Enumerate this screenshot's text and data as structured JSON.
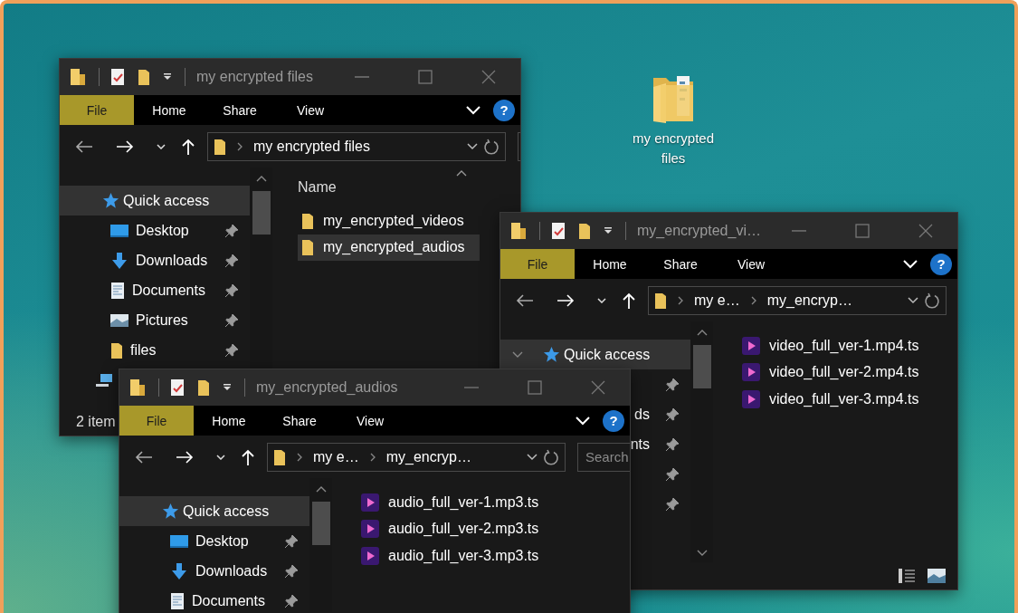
{
  "desktop": {
    "icon_label": "my encrypted files"
  },
  "windows": [
    {
      "title": "my encrypted files",
      "ribbon_tabs": [
        {
          "kind": "menu",
          "label": "File"
        },
        {
          "kind": "tab",
          "label": "Home"
        },
        {
          "kind": "tab",
          "label": "Share"
        },
        {
          "kind": "tab",
          "label": "View"
        }
      ],
      "help": "?",
      "breadcrumbs": [
        "my encrypted files"
      ],
      "sidebar": [
        {
          "kind": "quick",
          "label": "Quick access",
          "selected": true,
          "pinned": false
        },
        {
          "kind": "desktop",
          "label": "Desktop",
          "selected": false,
          "pinned": true
        },
        {
          "kind": "downloads",
          "label": "Downloads",
          "selected": false,
          "pinned": true
        },
        {
          "kind": "documents",
          "label": "Documents",
          "selected": false,
          "pinned": true
        },
        {
          "kind": "pictures",
          "label": "Pictures",
          "selected": false,
          "pinned": true
        },
        {
          "kind": "folder",
          "label": "files",
          "selected": false,
          "pinned": true
        },
        {
          "kind": "pc",
          "selected": false,
          "pinned": false
        }
      ],
      "column_header": "Name",
      "files": [
        {
          "kind": "folder",
          "name": "my_encrypted_videos",
          "selected": false
        },
        {
          "kind": "folder",
          "name": "my_encrypted_audios",
          "selected": true
        }
      ],
      "status": "2 item"
    },
    {
      "title": "my_encrypted_vi…",
      "ribbon_tabs": [
        {
          "kind": "menu",
          "label": "File"
        },
        {
          "kind": "tab",
          "label": "Home"
        },
        {
          "kind": "tab",
          "label": "Share"
        },
        {
          "kind": "tab",
          "label": "View"
        }
      ],
      "help": "?",
      "breadcrumbs": [
        "my e…",
        "my_encryp…"
      ],
      "sidebar": [
        {
          "kind": "quick",
          "label": "Quick access",
          "selected": true,
          "pinned": false,
          "expanded": true
        },
        {
          "kind": "covered",
          "selected": false,
          "pinned": true
        },
        {
          "kind": "covered",
          "label": "ds",
          "selected": false,
          "pinned": true
        },
        {
          "kind": "covered",
          "label": "nts",
          "selected": false,
          "pinned": true
        },
        {
          "kind": "covered",
          "selected": false,
          "pinned": true
        },
        {
          "kind": "covered",
          "selected": false,
          "pinned": true
        }
      ],
      "files": [
        {
          "kind": "media",
          "name": "video_full_ver-1.mp4.ts",
          "selected": false
        },
        {
          "kind": "media",
          "name": "video_full_ver-2.mp4.ts",
          "selected": false
        },
        {
          "kind": "media",
          "name": "video_full_ver-3.mp4.ts",
          "selected": false
        }
      ],
      "view_buttons": true
    },
    {
      "title": "my_encrypted_audios",
      "ribbon_tabs": [
        {
          "kind": "menu",
          "label": "File"
        },
        {
          "kind": "tab",
          "label": "Home"
        },
        {
          "kind": "tab",
          "label": "Share"
        },
        {
          "kind": "tab",
          "label": "View"
        }
      ],
      "help": "?",
      "breadcrumbs": [
        "my e…",
        "my_encryp…"
      ],
      "search_placeholder": "Search",
      "sidebar": [
        {
          "kind": "quick",
          "label": "Quick access",
          "selected": true,
          "pinned": false
        },
        {
          "kind": "desktop",
          "label": "Desktop",
          "selected": false,
          "pinned": true
        },
        {
          "kind": "downloads",
          "label": "Downloads",
          "selected": false,
          "pinned": true
        },
        {
          "kind": "documents",
          "label": "Documents",
          "selected": false,
          "pinned": true
        }
      ],
      "files": [
        {
          "kind": "media",
          "name": "audio_full_ver-1.mp3.ts",
          "selected": false
        },
        {
          "kind": "media",
          "name": "audio_full_ver-2.mp3.ts",
          "selected": false
        },
        {
          "kind": "media",
          "name": "audio_full_ver-3.mp3.ts",
          "selected": false
        }
      ]
    }
  ]
}
